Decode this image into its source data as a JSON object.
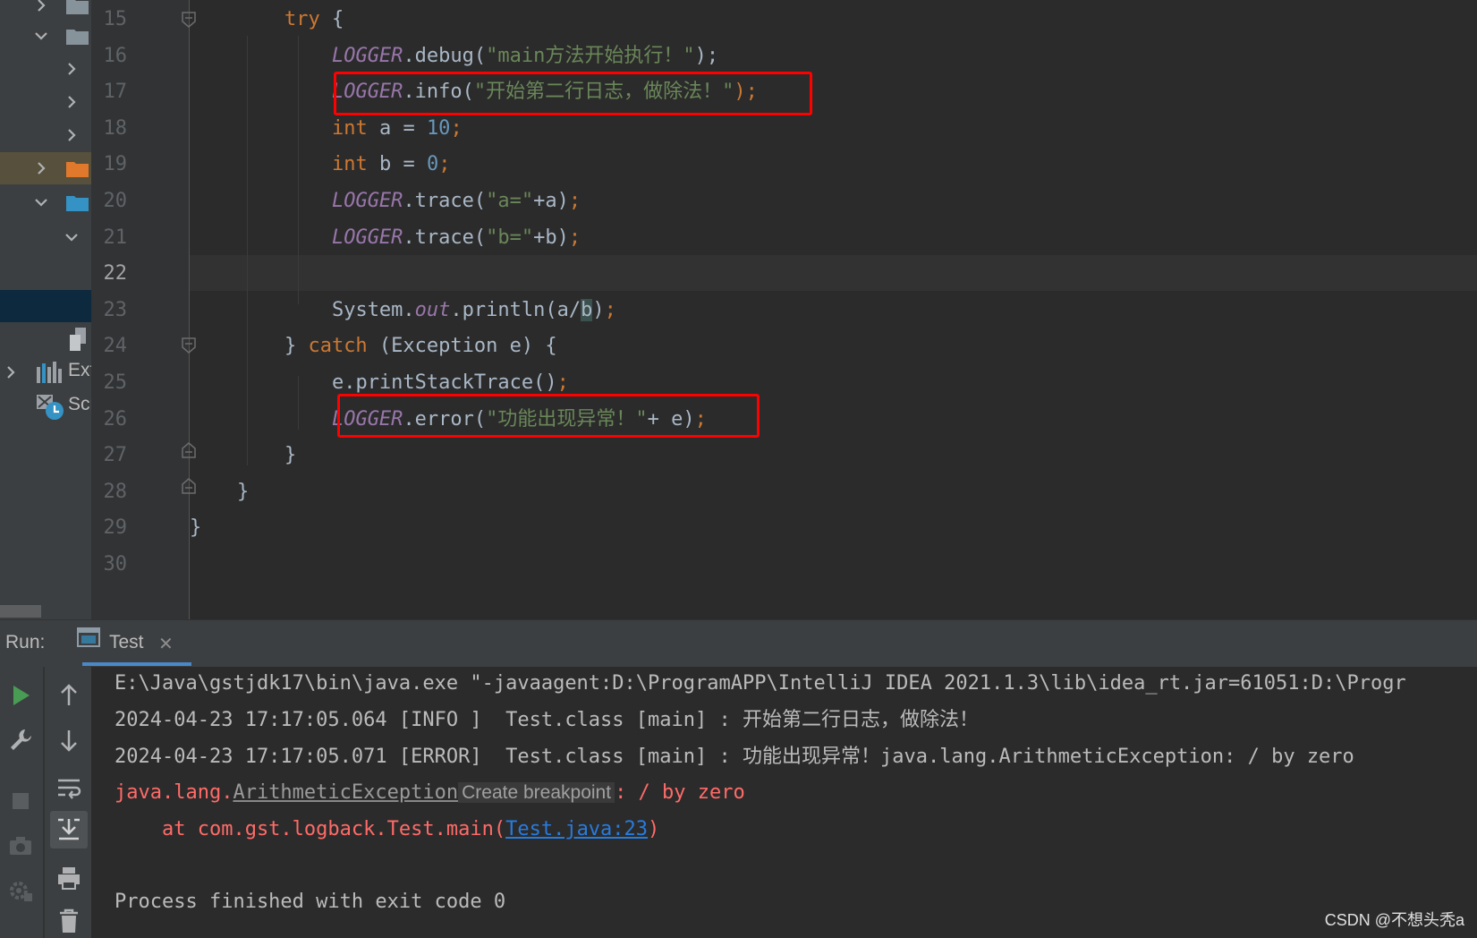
{
  "project_tree": {
    "items": [
      {
        "label": "Ext",
        "icon": "external-libraries-icon"
      },
      {
        "label": "Scr",
        "icon": "scratches-icon"
      }
    ]
  },
  "editor": {
    "current_line": 22,
    "lines": [
      {
        "num": "15",
        "tokens": [
          {
            "t": "        "
          },
          {
            "t": "try",
            "c": "kw"
          },
          {
            "t": " {"
          }
        ]
      },
      {
        "num": "16",
        "tokens": [
          {
            "t": "            "
          },
          {
            "t": "LOGGER",
            "c": "logger"
          },
          {
            "t": ".debug("
          },
          {
            "t": "\"main方法开始执行！\"",
            "c": "str"
          },
          {
            "t": ");"
          }
        ]
      },
      {
        "num": "17",
        "tokens": [
          {
            "t": "            "
          },
          {
            "t": "LOGGER",
            "c": "logger"
          },
          {
            "t": ".info("
          },
          {
            "t": "\"开始第二行日志，做除法！\"",
            "c": "str"
          },
          {
            "t": ");",
            "c": "kw"
          }
        ]
      },
      {
        "num": "18",
        "tokens": [
          {
            "t": "            "
          },
          {
            "t": "int",
            "c": "kw"
          },
          {
            "t": " a = "
          },
          {
            "t": "10",
            "c": "num"
          },
          {
            "t": ";",
            "c": "kw"
          }
        ]
      },
      {
        "num": "19",
        "tokens": [
          {
            "t": "            "
          },
          {
            "t": "int",
            "c": "kw"
          },
          {
            "t": " b = "
          },
          {
            "t": "0",
            "c": "num"
          },
          {
            "t": ";",
            "c": "kw"
          }
        ]
      },
      {
        "num": "20",
        "tokens": [
          {
            "t": "            "
          },
          {
            "t": "LOGGER",
            "c": "logger"
          },
          {
            "t": ".trace("
          },
          {
            "t": "\"a=\"",
            "c": "str"
          },
          {
            "t": "+a)"
          },
          {
            "t": ";",
            "c": "kw"
          }
        ]
      },
      {
        "num": "21",
        "tokens": [
          {
            "t": "            "
          },
          {
            "t": "LOGGER",
            "c": "logger"
          },
          {
            "t": ".trace("
          },
          {
            "t": "\"b=\"",
            "c": "str"
          },
          {
            "t": "+b)"
          },
          {
            "t": ";",
            "c": "kw"
          }
        ]
      },
      {
        "num": "22",
        "tokens": []
      },
      {
        "num": "23",
        "tokens": [
          {
            "t": "            "
          },
          {
            "t": "System."
          },
          {
            "t": "out",
            "c": "out"
          },
          {
            "t": ".println(a/"
          },
          {
            "t": "b",
            "c": "caret-hl"
          },
          {
            "t": ")"
          },
          {
            "t": ";",
            "c": "kw"
          }
        ]
      },
      {
        "num": "24",
        "tokens": [
          {
            "t": "        } "
          },
          {
            "t": "catch",
            "c": "kw"
          },
          {
            "t": " (Exception e) {"
          }
        ]
      },
      {
        "num": "25",
        "tokens": [
          {
            "t": "            "
          },
          {
            "t": "e.printStackTrace()"
          },
          {
            "t": ";",
            "c": "kw"
          }
        ]
      },
      {
        "num": "26",
        "tokens": [
          {
            "t": "            "
          },
          {
            "t": "LOGGER",
            "c": "logger"
          },
          {
            "t": ".error("
          },
          {
            "t": "\"功能出现异常！\"",
            "c": "str"
          },
          {
            "t": "+ e)"
          },
          {
            "t": ";",
            "c": "kw"
          }
        ]
      },
      {
        "num": "27",
        "tokens": [
          {
            "t": "        }"
          }
        ]
      },
      {
        "num": "28",
        "tokens": [
          {
            "t": "    }"
          }
        ]
      },
      {
        "num": "29",
        "tokens": [
          {
            "t": "}"
          }
        ]
      },
      {
        "num": "30",
        "tokens": []
      }
    ]
  },
  "run": {
    "label": "Run:",
    "tab_label": "Test",
    "console": {
      "line1": "E:\\Java\\gstjdk17\\bin\\java.exe \"-javaagent:D:\\ProgramAPP\\IntelliJ IDEA 2021.1.3\\lib\\idea_rt.jar=61051:D:\\Progr",
      "line2": "2024-04-23 17:17:05.064 [INFO ]  Test.class [main] : 开始第二行日志，做除法！",
      "line3": "2024-04-23 17:17:05.071 [ERROR]  Test.class [main] : 功能出现异常！java.lang.ArithmeticException: / by zero",
      "line4_prefix": "java.lang.",
      "line4_class": "ArithmeticException",
      "line4_tooltip": "Create breakpoint",
      "line4_suffix": ": / by zero",
      "line5_prefix": "    at com.gst.logback.Test.main(",
      "line5_link": "Test.java:23",
      "line5_suffix": ")",
      "line7": "Process finished with exit code 0"
    }
  },
  "watermark": "CSDN @不想头秃a",
  "colors": {
    "keyword": "#cc7832",
    "string": "#6a8759",
    "number": "#6897bb",
    "field": "#9876aa",
    "error": "#ff6b68",
    "link": "#287bde",
    "highlight_box": "#ff0000",
    "run_green": "#499c54"
  }
}
